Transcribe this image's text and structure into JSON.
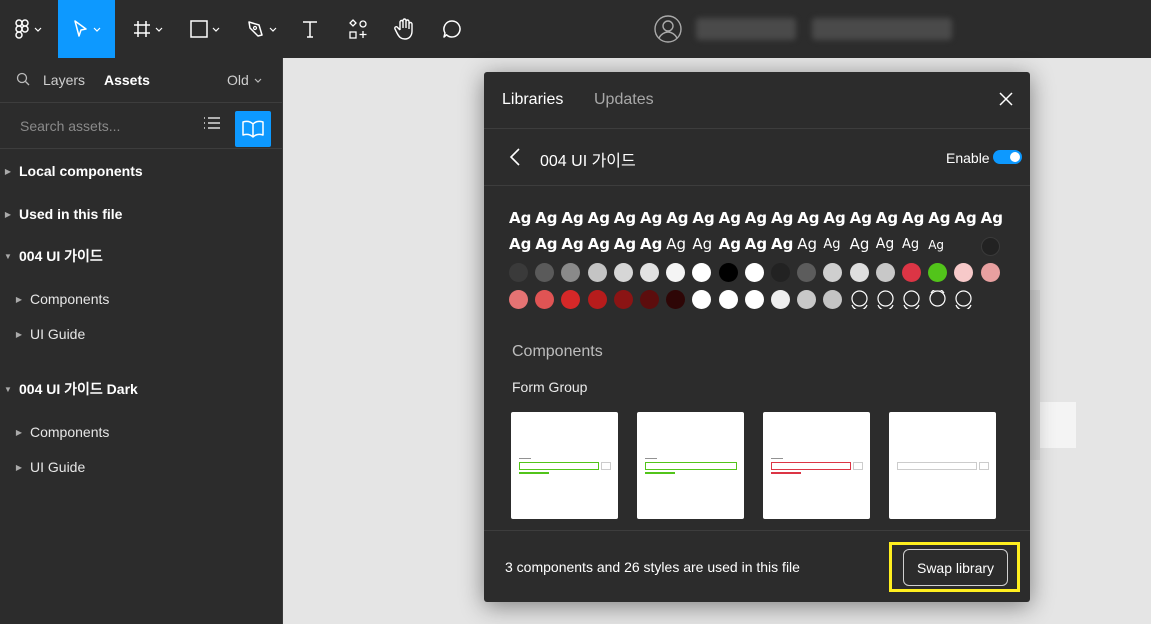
{
  "toolbar": {
    "tools": [
      "figma-menu",
      "move",
      "frame",
      "shape",
      "pen",
      "text",
      "components",
      "hand",
      "comment"
    ]
  },
  "left_panel": {
    "tab_layers": "Layers",
    "tab_assets": "Assets",
    "tab_old": "Old",
    "search_placeholder": "Search assets...",
    "tree": [
      {
        "label": "Local components"
      },
      {
        "label": "Used in this file"
      },
      {
        "label": "004 UI 가이드"
      },
      {
        "label": "Components"
      },
      {
        "label": "UI Guide"
      },
      {
        "label": "004 UI 가이드 Dark"
      },
      {
        "label": "Components"
      },
      {
        "label": "UI Guide"
      }
    ]
  },
  "modal": {
    "tab_libraries": "Libraries",
    "tab_updates": "Updates",
    "library_name": "004 UI 가이드",
    "enable_label": "Enable",
    "enabled": true,
    "text_style_sample": "Ag",
    "components_heading": "Components",
    "group_heading": "Form Group",
    "footer_text": "3 components and 26 styles are used in this file",
    "swap_button": "Swap library",
    "colors": {
      "row3": [
        "#3a3a3a",
        "#5a5a5a",
        "#8a8a8a",
        "#c4c4c4",
        "#d6d6d6",
        "#e2e2e2",
        "#f4f4f4",
        "#ffffff",
        "#000000",
        "#ffffff",
        "#222222",
        "#5c5c5c",
        "#cfcfcf",
        "#dedede",
        "#c8c8c8",
        "#dc3545",
        "#52c41a",
        "#f7c9c9",
        "#e8a0a0"
      ],
      "row4": [
        "#e57373",
        "#e05454",
        "#d62828",
        "#b71c1c",
        "#8b1414",
        "#5c0d0d",
        "#2e0606",
        "#ffffff",
        "#ffffff",
        "#ffffff",
        "#efefef",
        "#c8c8c8",
        "#c4c4c4"
      ]
    }
  }
}
